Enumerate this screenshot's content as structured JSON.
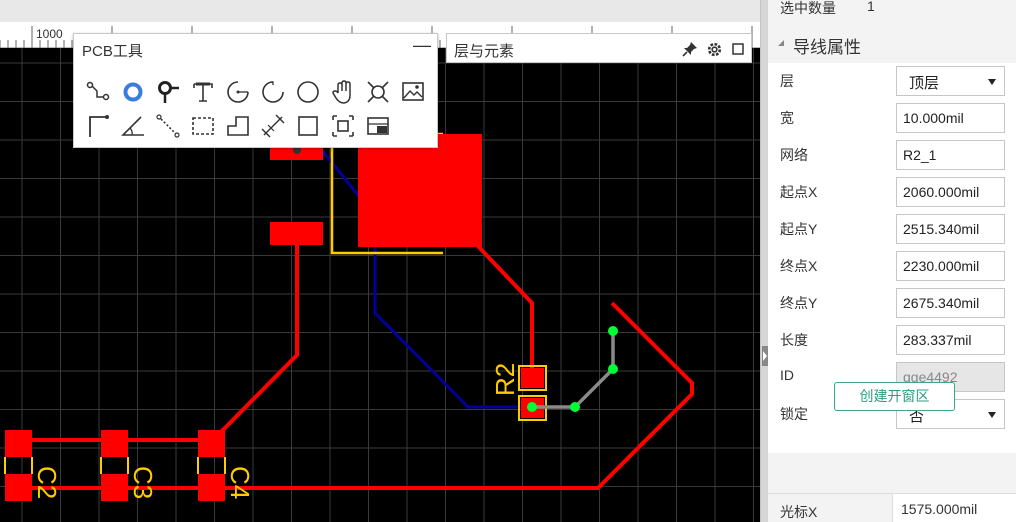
{
  "ruler": {
    "start_label": "1000"
  },
  "pcb_tools": {
    "title": "PCB工具",
    "minimize_glyph": "—",
    "tools_row1": [
      "wire-tool-icon",
      "via-tool-icon",
      "pad-tool-icon",
      "text-tool-icon",
      "arc-center-tool-icon",
      "arc-tool-icon",
      "circle-tool-icon",
      "pan-hand-icon",
      "measure-tool-icon",
      "image-tool-icon"
    ],
    "tools_row2": [
      "trace-tool-icon",
      "angle-tool-icon",
      "dotted-line-tool-icon",
      "dashed-rect-tool-icon",
      "polygon-tool-icon",
      "dimension-tool-icon",
      "rectangle-tool-icon",
      "component-tool-icon",
      "copper-area-tool-icon"
    ]
  },
  "layers_panel": {
    "title": "层与元素"
  },
  "canvas": {
    "labels": {
      "r2": "R2",
      "c2": "C2",
      "c3": "C3",
      "c4": "C4"
    },
    "colors": {
      "background": "#000000",
      "grid": "#3a3a3a",
      "top_copper": "#ff0000",
      "bottom_trace": "#000099",
      "silkscreen": "#ffcc00",
      "selected_wire": "#8a8a8a",
      "handle": "#00ff33"
    }
  },
  "right_panel": {
    "selected_count_label": "选中数量",
    "selected_count_value": "1",
    "section_title": "导线属性",
    "properties": [
      {
        "label": "层",
        "value": "顶层",
        "type": "select"
      },
      {
        "label": "宽",
        "value": "10.000mil",
        "type": "input"
      },
      {
        "label": "网络",
        "value": "R2_1",
        "type": "input"
      },
      {
        "label": "起点X",
        "value": "2060.000mil",
        "type": "input"
      },
      {
        "label": "起点Y",
        "value": "2515.340mil",
        "type": "input"
      },
      {
        "label": "终点X",
        "value": "2230.000mil",
        "type": "input"
      },
      {
        "label": "终点Y",
        "value": "2675.340mil",
        "type": "input"
      },
      {
        "label": "长度",
        "value": "283.337mil",
        "type": "input"
      },
      {
        "label": "ID",
        "value": "",
        "placeholder": "gge4492",
        "type": "input-disabled"
      },
      {
        "label": "锁定",
        "value": "否",
        "type": "select"
      }
    ],
    "create_button": "创建开窗区",
    "cursor_label": "光标X",
    "cursor_value": "1575.000mil"
  }
}
